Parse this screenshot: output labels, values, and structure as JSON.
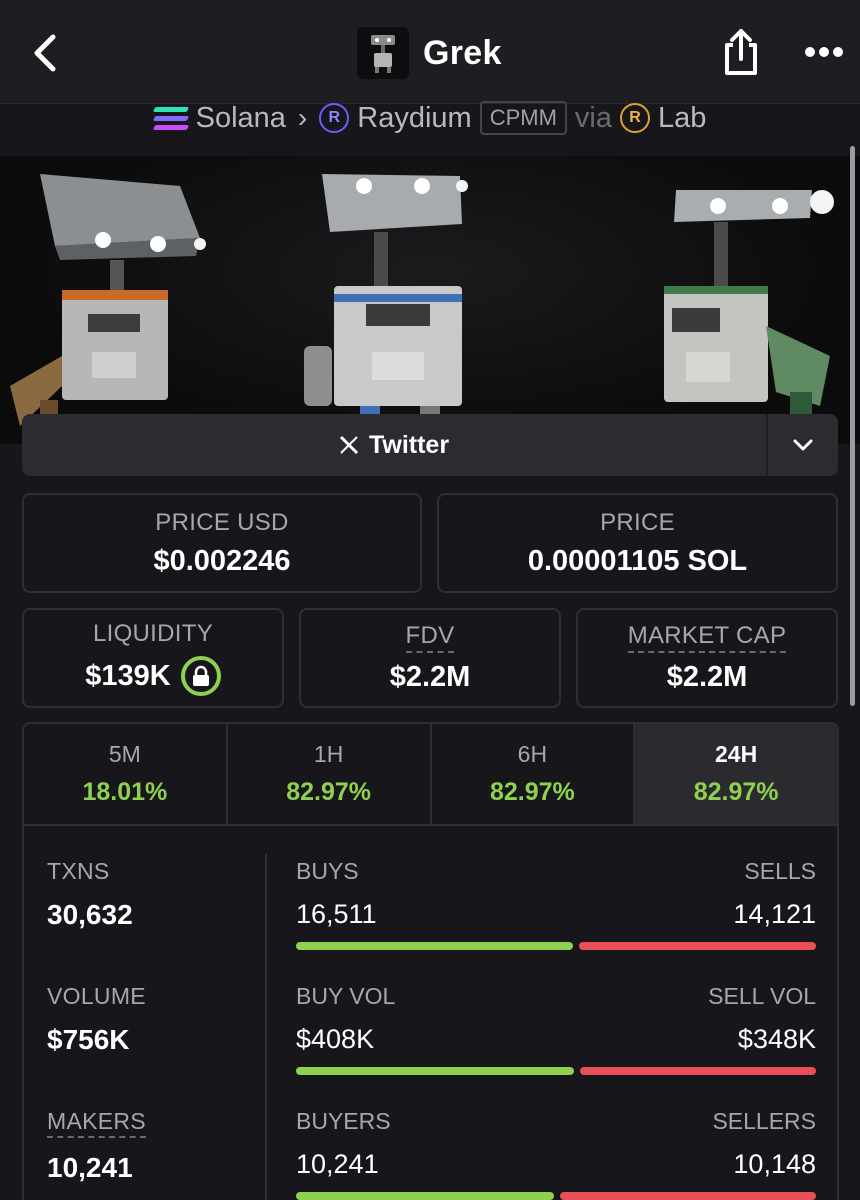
{
  "header": {
    "token_name": "Grek",
    "icons": {
      "back": "chevron-left-icon",
      "share": "share-icon",
      "more": "more-dots-icon"
    }
  },
  "breadcrumb": {
    "chain": "Solana",
    "dex": "Raydium",
    "pool_type": "CPMM",
    "via": "via",
    "launchpad": "Lab"
  },
  "socials": {
    "twitter_label": "Twitter"
  },
  "price_usd": {
    "label": "PRICE USD",
    "value": "$0.002246"
  },
  "price_native": {
    "label": "PRICE",
    "value": "0.00001105 SOL"
  },
  "liquidity": {
    "label": "LIQUIDITY",
    "value": "$139K"
  },
  "fdv": {
    "label": "FDV",
    "value": "$2.2M"
  },
  "market_cap": {
    "label": "MARKET CAP",
    "value": "$2.2M"
  },
  "timeframes": [
    {
      "label": "5M",
      "change": "18.01%"
    },
    {
      "label": "1H",
      "change": "82.97%"
    },
    {
      "label": "6H",
      "change": "82.97%"
    },
    {
      "label": "24H",
      "change": "82.97%",
      "active": true
    }
  ],
  "stats": {
    "txns": {
      "label": "TXNS",
      "value": "30,632"
    },
    "volume": {
      "label": "VOLUME",
      "value": "$756K"
    },
    "makers": {
      "label": "MAKERS",
      "value": "10,241"
    },
    "buys_sells": {
      "left_label": "BUYS",
      "right_label": "SELLS",
      "left_value": "16,511",
      "right_value": "14,121",
      "buy_fraction": 0.539
    },
    "vol_split": {
      "left_label": "BUY VOL",
      "right_label": "SELL VOL",
      "left_value": "$408K",
      "right_value": "$348K",
      "buy_fraction": 0.54
    },
    "buyers_sellers": {
      "left_label": "BUYERS",
      "right_label": "SELLERS",
      "left_value": "10,241",
      "right_value": "10,148",
      "buy_fraction": 0.502
    }
  },
  "colors": {
    "positive": "#8fd14f",
    "negative": "#ea4f55",
    "background": "#17171b"
  }
}
